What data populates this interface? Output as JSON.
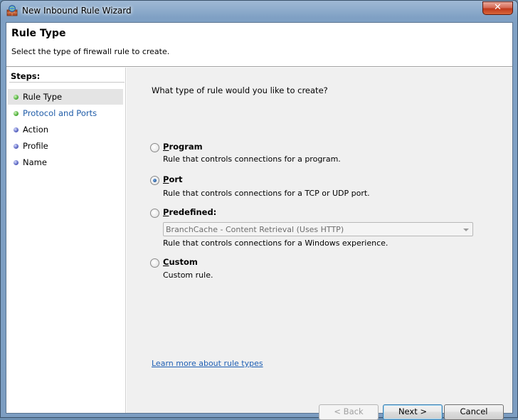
{
  "window": {
    "title": "New Inbound Rule Wizard",
    "close_glyph": "✕"
  },
  "header": {
    "title": "Rule Type",
    "description": "Select the type of firewall rule to create."
  },
  "steps": {
    "title": "Steps:",
    "items": [
      {
        "label": "Rule Type",
        "status": "completed",
        "active": true
      },
      {
        "label": "Protocol and Ports",
        "status": "completed",
        "active": false
      },
      {
        "label": "Action",
        "status": "pending",
        "active": false
      },
      {
        "label": "Profile",
        "status": "pending",
        "active": false
      },
      {
        "label": "Name",
        "status": "pending",
        "active": false
      }
    ]
  },
  "main": {
    "question": "What type of rule would you like to create?",
    "options": [
      {
        "label_first": "P",
        "label_rest": "rogram",
        "description": "Rule that controls connections for a program.",
        "checked": false
      },
      {
        "label_first": "P",
        "label_rest": "ort",
        "description": "Rule that controls connections for a TCP or UDP port.",
        "checked": true
      },
      {
        "label_first": "P",
        "label_rest": "redefined:",
        "description": "Rule that controls connections for a Windows experience.",
        "checked": false
      },
      {
        "label_first": "C",
        "label_rest": "ustom",
        "description": "Custom rule.",
        "checked": false
      }
    ],
    "predefined_select": {
      "value": "BranchCache - Content Retrieval (Uses HTTP)"
    },
    "learn_more": "Learn more about rule types"
  },
  "buttons": {
    "back": "< Back",
    "next": "Next >",
    "cancel": "Cancel"
  },
  "colors": {
    "link": "#1e5fb4",
    "step_done": "#3fa52a",
    "step_pending": "#4b56b8"
  }
}
